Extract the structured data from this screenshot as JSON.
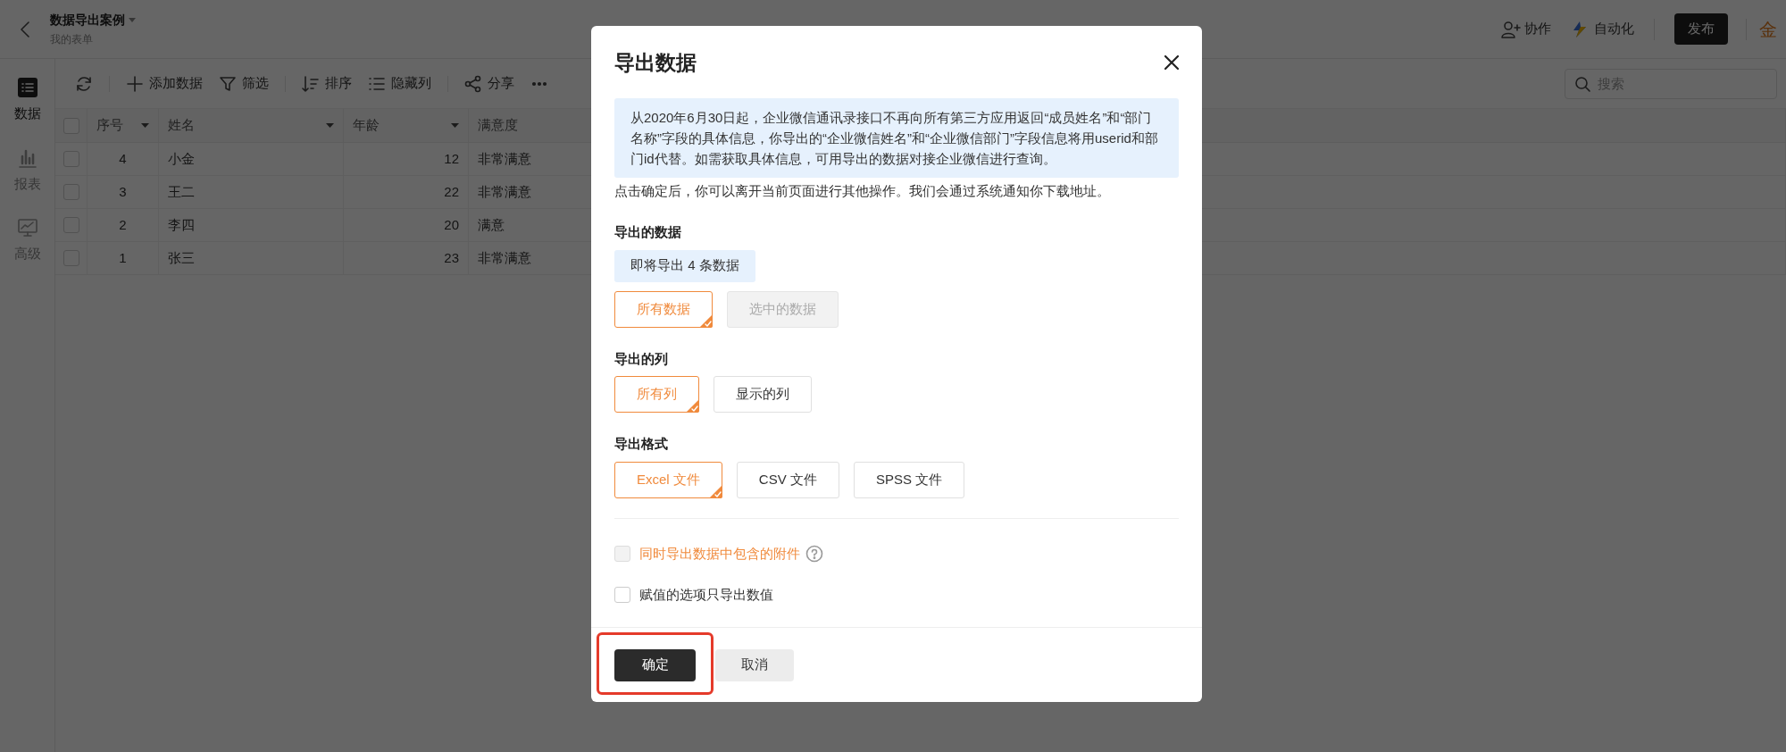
{
  "header": {
    "title": "数据导出案例",
    "subtitle": "我的表单",
    "actions": [
      "协作",
      "自动化"
    ],
    "publish": "发布",
    "logo": "金"
  },
  "sidebar": {
    "items": [
      {
        "label": "数据",
        "kind": "list",
        "selected": true
      },
      {
        "label": "报表",
        "kind": "chart",
        "selected": false
      },
      {
        "label": "高级",
        "kind": "board",
        "selected": false
      }
    ]
  },
  "toolbar": {
    "items": [
      {
        "kind": "refresh"
      },
      {
        "kind": "add",
        "label": "添加数据"
      },
      {
        "kind": "filter",
        "label": "筛选"
      },
      {
        "kind": "sort",
        "label": "排序"
      },
      {
        "kind": "columns",
        "label": "隐藏列"
      },
      {
        "kind": "share",
        "label": "分享"
      },
      {
        "kind": "more"
      }
    ],
    "search": {
      "placeholder": "搜索"
    }
  },
  "table": {
    "select_all": {
      "checked": false
    },
    "columns": [
      {
        "label": "序号",
        "dropdown": true
      },
      {
        "label": "姓名",
        "dropdown": true
      },
      {
        "label": "年龄",
        "dropdown": true
      },
      {
        "label": "满意度",
        "dropdown": false
      }
    ],
    "rows": [
      {
        "checked": false,
        "cells": [
          "4",
          "小金",
          "12",
          "非常满意"
        ]
      },
      {
        "checked": false,
        "cells": [
          "3",
          "王二",
          "22",
          "非常满意"
        ]
      },
      {
        "checked": false,
        "cells": [
          "2",
          "李四",
          "20",
          "满意"
        ]
      },
      {
        "checked": false,
        "cells": [
          "1",
          "张三",
          "23",
          "非常满意"
        ]
      }
    ]
  },
  "dialog": {
    "title": "导出数据",
    "notice": "从2020年6月30日起，企业微信通讯录接口不再向所有第三方应用返回“成员姓名”和“部门名称”字段的具体信息，你导出的“企业微信姓名”和“企业微信部门”字段信息将用userid和部门id代替。如需获取具体信息，可用导出的数据对接企业微信进行查询。",
    "hint": "点击确定后，你可以离开当前页面进行其他操作。我们会通过系统通知你下载地址。",
    "sections": [
      {
        "title": "导出的数据",
        "note": "即将导出 4 条数据",
        "options": [
          {
            "label": "所有数据",
            "selected": true,
            "disabled": false
          },
          {
            "label": "选中的数据",
            "selected": false,
            "disabled": true
          }
        ]
      },
      {
        "title": "导出的列",
        "options": [
          {
            "label": "所有列",
            "selected": true,
            "disabled": false
          },
          {
            "label": "显示的列",
            "selected": false,
            "disabled": false
          }
        ]
      },
      {
        "title": "导出格式",
        "options": [
          {
            "label": "Excel 文件",
            "selected": true,
            "disabled": false
          },
          {
            "label": "CSV 文件",
            "selected": false,
            "disabled": false
          },
          {
            "label": "SPSS 文件",
            "selected": false,
            "disabled": false
          }
        ]
      }
    ],
    "checkboxes": [
      {
        "label": "同时导出数据中包含的附件",
        "checked": false,
        "disabled": true,
        "accent": true,
        "help": true
      },
      {
        "label": "赋值的选项只导出数值",
        "checked": false,
        "disabled": false,
        "accent": false,
        "help": false
      }
    ],
    "confirm": {
      "label": "确定",
      "highlighted": true
    },
    "cancel": "取消"
  }
}
